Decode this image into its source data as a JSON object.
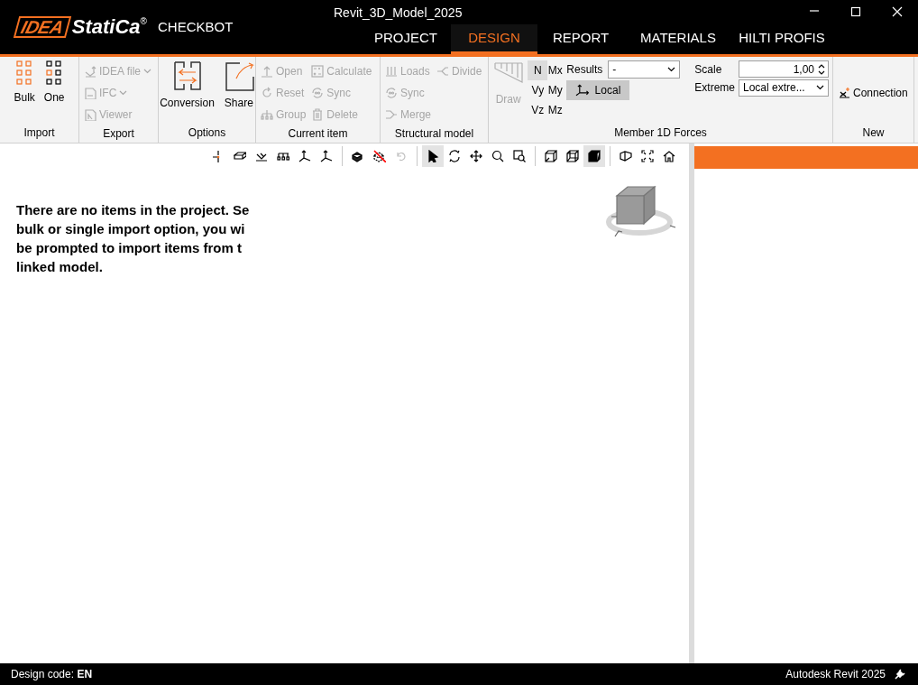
{
  "window": {
    "title": "Revit_3D_Model_2025",
    "app_name": "CHECKBOT"
  },
  "logo": {
    "mark": "IDEA",
    "name": "StatiCa",
    "registered": "®"
  },
  "tabs": [
    {
      "label": "PROJECT",
      "selected": false
    },
    {
      "label": "DESIGN",
      "selected": true
    },
    {
      "label": "REPORT",
      "selected": false
    },
    {
      "label": "MATERIALS",
      "selected": false
    },
    {
      "label": "HILTI PROFIS",
      "selected": false
    }
  ],
  "ribbon": {
    "groups": [
      {
        "label": "Import",
        "kind": "large",
        "buttons": [
          {
            "label": "Bulk",
            "disabled": false
          },
          {
            "label": "One",
            "disabled": false
          }
        ]
      },
      {
        "label": "Export",
        "kind": "small",
        "columns": [
          [
            {
              "label": "IDEA file",
              "has_menu": true,
              "disabled": true
            },
            {
              "label": "IFC",
              "has_menu": true,
              "disabled": true
            },
            {
              "label": "Viewer",
              "has_menu": false,
              "disabled": true
            }
          ]
        ]
      },
      {
        "label": "Options",
        "kind": "large",
        "buttons": [
          {
            "label": "Conversion",
            "disabled": false
          },
          {
            "label": "Share",
            "disabled": false
          }
        ]
      },
      {
        "label": "Current item",
        "kind": "small",
        "columns": [
          [
            {
              "label": "Open",
              "has_menu": false,
              "disabled": true
            },
            {
              "label": "Reset",
              "has_menu": false,
              "disabled": true
            },
            {
              "label": "Group",
              "has_menu": false,
              "disabled": true
            }
          ],
          [
            {
              "label": "Calculate",
              "has_menu": false,
              "disabled": true
            },
            {
              "label": "Sync",
              "has_menu": false,
              "disabled": true
            },
            {
              "label": "Delete",
              "has_menu": false,
              "disabled": true
            }
          ]
        ]
      },
      {
        "label": "Structural model",
        "kind": "small",
        "columns": [
          [
            {
              "label": "Loads",
              "has_menu": false,
              "disabled": true
            },
            {
              "label": "Sync",
              "has_menu": false,
              "disabled": true
            },
            {
              "label": "Merge",
              "has_menu": false,
              "disabled": true
            }
          ],
          [
            {
              "label": "Divide",
              "has_menu": false,
              "disabled": true
            }
          ]
        ]
      },
      {
        "label": "Member 1D Forces",
        "kind": "forces",
        "draw": {
          "label": "Draw",
          "disabled": true
        },
        "components": [
          {
            "label": "N",
            "selected": true
          },
          {
            "label": "Mx",
            "selected": false
          },
          {
            "label": "Vy",
            "selected": false
          },
          {
            "label": "My",
            "selected": false
          },
          {
            "label": "Vz",
            "selected": false
          },
          {
            "label": "Mz",
            "selected": false
          }
        ],
        "results": {
          "label": "Results",
          "value": "-"
        },
        "local": {
          "label": "Local",
          "selected": true
        },
        "scale": {
          "label": "Scale",
          "value": "1,00"
        },
        "extreme": {
          "label": "Extreme",
          "value": "Local extre..."
        }
      },
      {
        "label": "New",
        "kind": "small",
        "columns": [
          [
            {
              "label": "Connection",
              "has_menu": false,
              "disabled": false
            }
          ]
        ]
      }
    ]
  },
  "toolbar": [
    [
      {
        "selected": false,
        "disabled": false
      },
      {
        "selected": false,
        "disabled": false
      },
      {
        "selected": false,
        "disabled": false
      },
      {
        "selected": false,
        "disabled": false
      },
      {
        "selected": false,
        "disabled": false
      },
      {
        "selected": false,
        "disabled": false
      }
    ],
    [
      {
        "selected": false,
        "disabled": false
      },
      {
        "selected": false,
        "disabled": false
      },
      {
        "selected": false,
        "disabled": true
      }
    ],
    [
      {
        "selected": true,
        "disabled": false
      },
      {
        "selected": false,
        "disabled": false
      },
      {
        "selected": false,
        "disabled": false
      },
      {
        "selected": false,
        "disabled": false
      },
      {
        "selected": false,
        "disabled": false
      }
    ],
    [
      {
        "selected": false,
        "disabled": false
      },
      {
        "selected": false,
        "disabled": false
      },
      {
        "selected": true,
        "disabled": false
      }
    ],
    [
      {
        "selected": false,
        "disabled": false
      },
      {
        "selected": false,
        "disabled": false
      },
      {
        "selected": false,
        "disabled": false
      }
    ]
  ],
  "canvas": {
    "message_lines": [
      "There are no items in the project. Se",
      "bulk or single import option, you wi",
      "be prompted to import items from t",
      "linked model."
    ]
  },
  "status_bar": {
    "design_code": "Design code: **EN**",
    "platform": "Autodesk Revit 2025"
  }
}
